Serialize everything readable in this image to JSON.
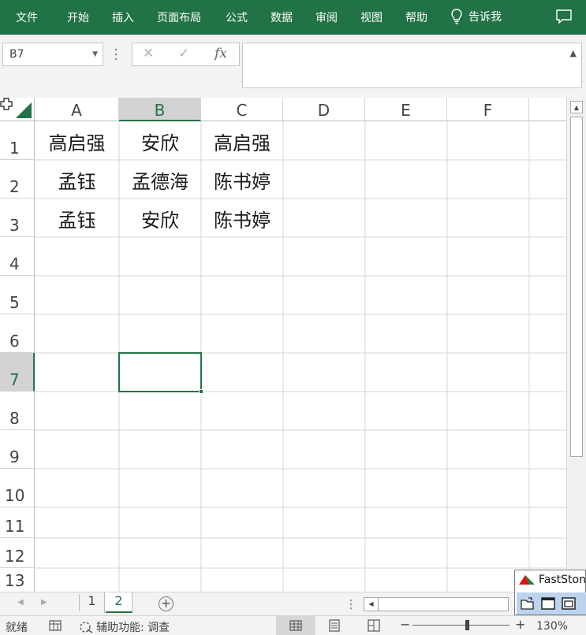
{
  "ribbon": {
    "tabs": [
      "文件",
      "开始",
      "插入",
      "页面布局",
      "公式",
      "数据",
      "审阅",
      "视图",
      "帮助"
    ],
    "tell_me": "告诉我",
    "bulb_icon": "lightbulb-icon",
    "comment_icon": "comment-icon"
  },
  "formula_bar": {
    "name_box": "B7",
    "cancel_symbol": "✕",
    "enter_symbol": "✓",
    "fx_symbol": "fx",
    "content": ""
  },
  "grid": {
    "columns": [
      "A",
      "B",
      "C",
      "D",
      "E",
      "F"
    ],
    "selected_column": "B",
    "rows": [
      "1",
      "2",
      "3",
      "4",
      "5",
      "6",
      "7",
      "8",
      "9",
      "10",
      "11",
      "12",
      "13"
    ],
    "selected_row": "7",
    "cells": [
      [
        "高启强",
        "安欣",
        "高启强"
      ],
      [
        "孟钰",
        "孟德海",
        "陈书婷"
      ],
      [
        "孟钰",
        "安欣",
        "陈书婷"
      ]
    ]
  },
  "sheets": {
    "tabs": [
      "1",
      "2"
    ],
    "active": "2"
  },
  "popup": {
    "title": "FastSton"
  },
  "status": {
    "ready": "就绪",
    "accessibility": "辅助功能: 调查",
    "zoom": "130%",
    "zoom_minus": "−",
    "zoom_plus": "+"
  },
  "colors": {
    "accent": "#217346",
    "header_selected": "#d2d2d2",
    "gridline": "#d4d4d4"
  }
}
